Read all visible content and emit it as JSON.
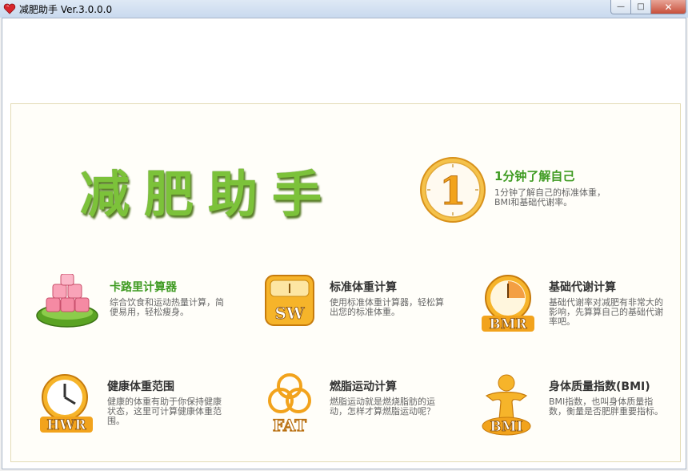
{
  "window": {
    "title": "减肥助手 Ver.3.0.0.0",
    "min_glyph": "—",
    "max_glyph": "□",
    "close_glyph": "✕"
  },
  "banner": {
    "title": "减肥助手"
  },
  "quick": {
    "digit": "1",
    "title": "1分钟了解自己",
    "desc": "1分钟了解自己的标准体重，BMI和基础代谢率。"
  },
  "tools": [
    {
      "title": "卡路里计算器",
      "desc": "综合饮食和运动热量计算，简便易用，轻松瘦身。",
      "icon": "calorie-cubes-icon"
    },
    {
      "title": "标准体重计算",
      "desc": "使用标准体重计算器，轻松算出您的标准体重。",
      "icon": "scale-sw-icon",
      "badge": "SW"
    },
    {
      "title": "基础代谢计算",
      "desc": "基础代谢率对减肥有非常大的影响，先算算自己的基础代谢率吧。",
      "icon": "bmr-clock-icon",
      "badge": "BMR"
    },
    {
      "title": "健康体重范围",
      "desc": "健康的体重有助于你保持健康状态，这里可计算健康体重范围。",
      "icon": "hwr-clock-icon",
      "badge": "HWR"
    },
    {
      "title": "燃脂运动计算",
      "desc": "燃脂运动就是燃烧脂肪的运动，怎样才算燃脂运动呢？",
      "icon": "fat-rings-icon",
      "badge": "FAT"
    },
    {
      "title": "身体质量指数(BMI)",
      "desc": "BMI指数，也叫身体质量指数，衡量是否肥胖重要指标。",
      "icon": "bmi-figure-icon",
      "badge": "BMI"
    }
  ],
  "colors": {
    "accent_green": "#3f9b22",
    "title_green": "#7cc23a",
    "gold": "#f2a31c"
  }
}
